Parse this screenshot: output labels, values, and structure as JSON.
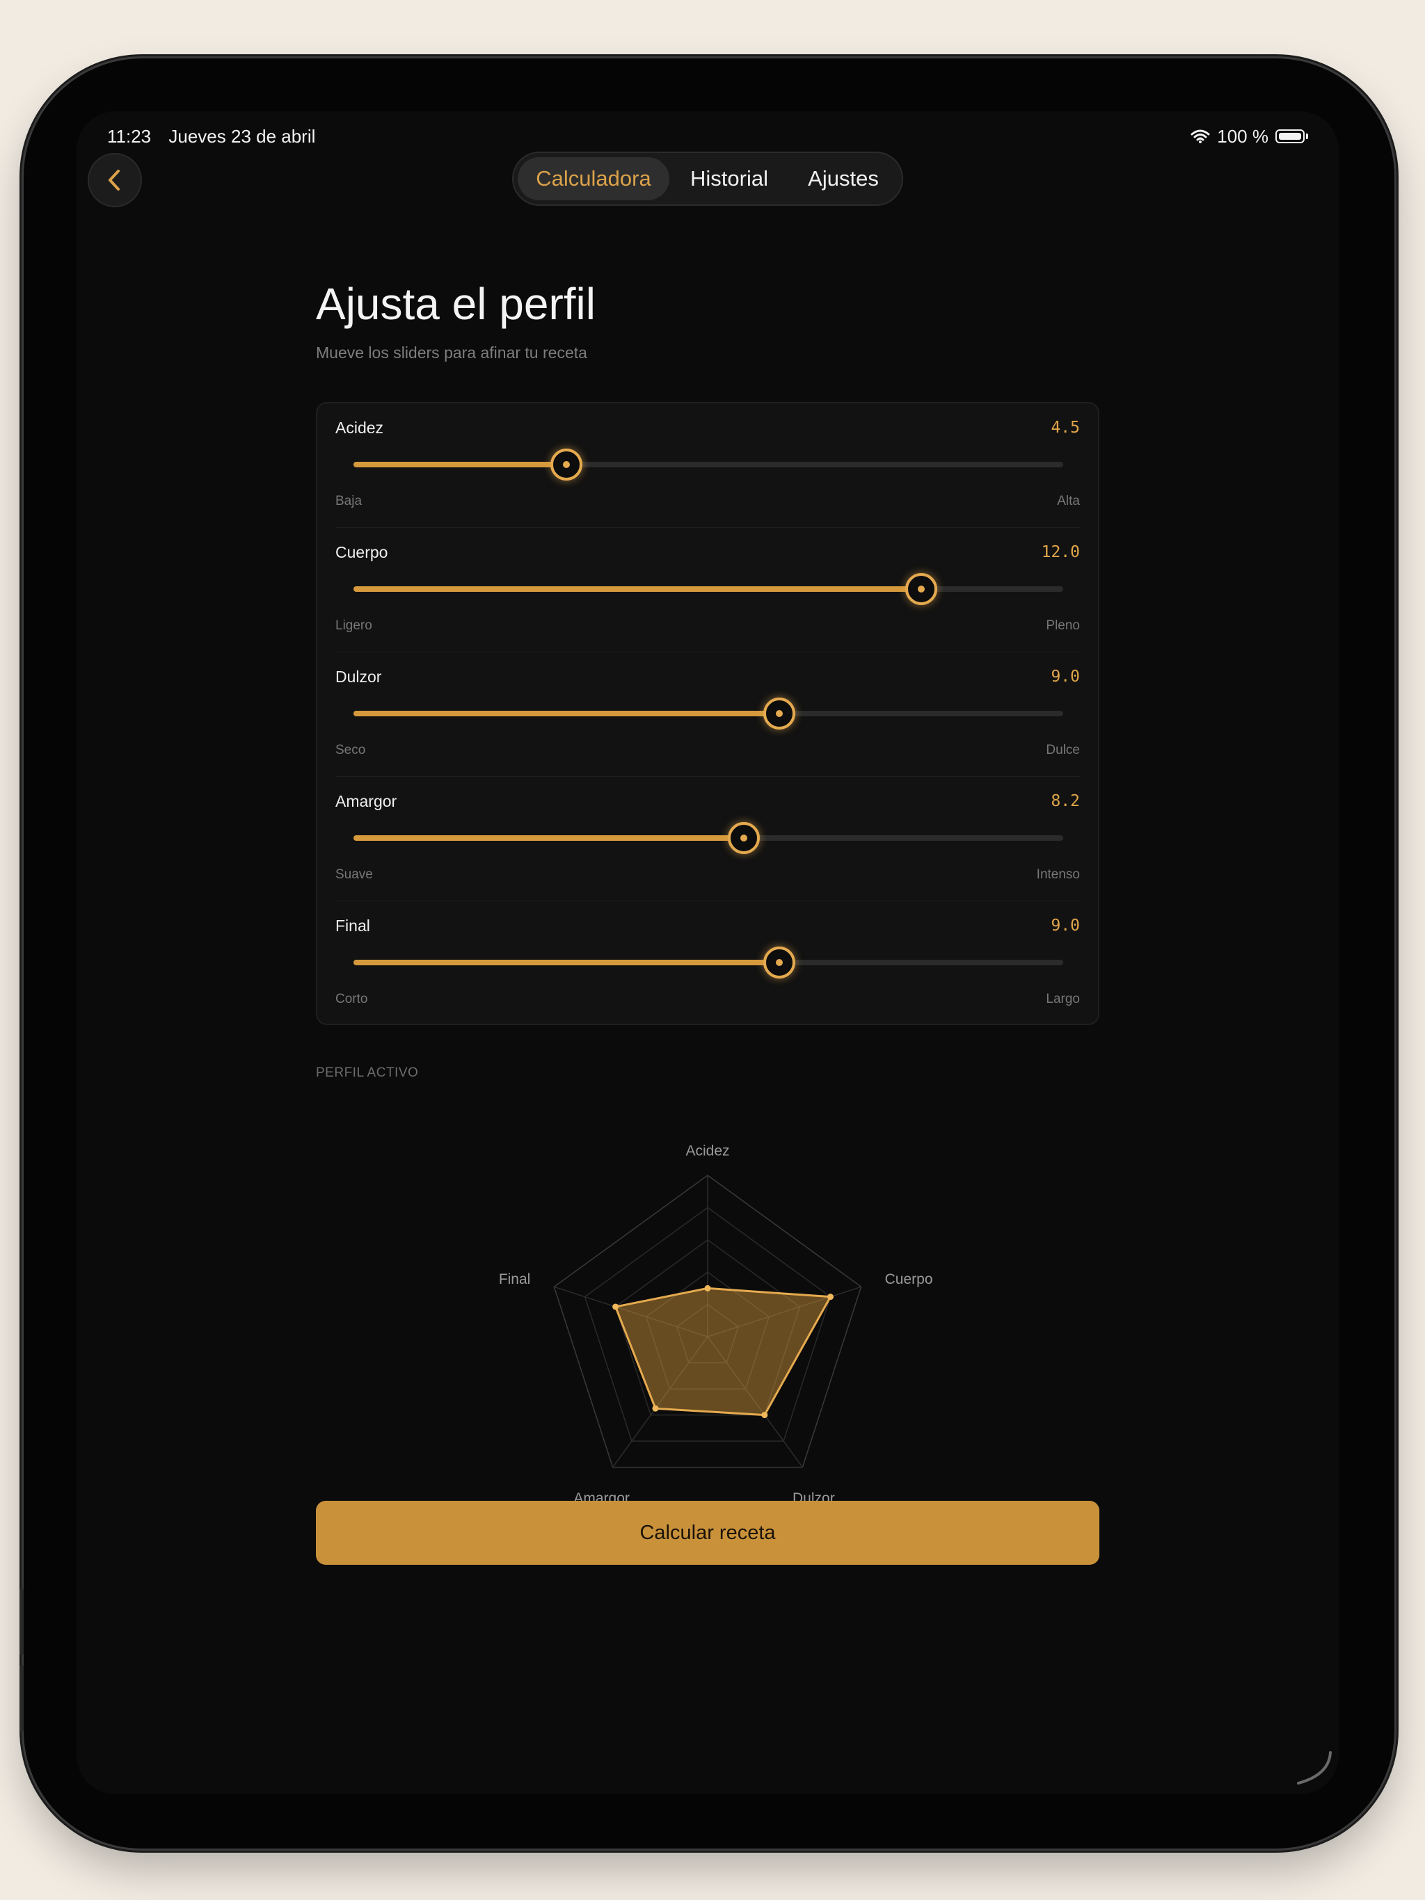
{
  "status_bar": {
    "time": "11:23",
    "date": "Jueves 23 de abril",
    "battery": "100 %"
  },
  "tabs": [
    {
      "label": "Calculadora",
      "active": true
    },
    {
      "label": "Historial",
      "active": false
    },
    {
      "label": "Ajustes",
      "active": false
    }
  ],
  "header": {
    "title": "Ajusta el perfil",
    "subtitle": "Mueve los sliders para afinar tu receta"
  },
  "sliders": [
    {
      "name": "Acidez",
      "value_text": "4.5",
      "fraction": 0.3,
      "low": "Baja",
      "high": "Alta"
    },
    {
      "name": "Cuerpo",
      "value_text": "12.0",
      "fraction": 0.8,
      "low": "Ligero",
      "high": "Pleno"
    },
    {
      "name": "Dulzor",
      "value_text": "9.0",
      "fraction": 0.6,
      "low": "Seco",
      "high": "Dulce"
    },
    {
      "name": "Amargor",
      "value_text": "8.2",
      "fraction": 0.55,
      "low": "Suave",
      "high": "Intenso"
    },
    {
      "name": "Final",
      "value_text": "9.0",
      "fraction": 0.6,
      "low": "Corto",
      "high": "Largo"
    }
  ],
  "profile": {
    "section_label": "PERFIL ACTIVO",
    "axes": [
      "Acidez",
      "Cuerpo",
      "Dulzor",
      "Amargor",
      "Final"
    ],
    "values": [
      0.3,
      0.8,
      0.6,
      0.55,
      0.6
    ],
    "grid_levels": 5
  },
  "cta": {
    "label": "Calcular receta"
  },
  "colors": {
    "accent": "#e5aa4f",
    "button": "#c9923a",
    "background": "#0b0b0b"
  },
  "icons": {
    "back": "chevron-left-icon",
    "wifi": "wifi-icon",
    "battery": "battery-icon"
  }
}
